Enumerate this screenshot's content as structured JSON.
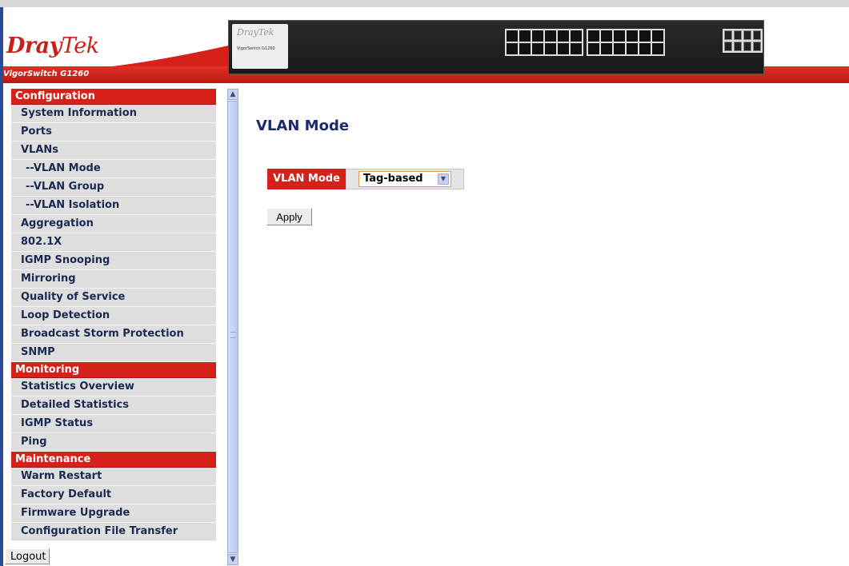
{
  "header": {
    "logo_bold": "Dray",
    "logo_rest": "Tek",
    "model": "VigorSwitch G1260",
    "device_logo": "DrayTek",
    "device_model": "VigorSwitch G1260"
  },
  "sidebar": {
    "sections": [
      {
        "title": "Configuration",
        "items": [
          {
            "label": "System Information",
            "sub": false
          },
          {
            "label": "Ports",
            "sub": false
          },
          {
            "label": "VLANs",
            "sub": false
          },
          {
            "label": "--VLAN Mode",
            "sub": true
          },
          {
            "label": "--VLAN Group",
            "sub": true
          },
          {
            "label": "--VLAN Isolation",
            "sub": true
          },
          {
            "label": "Aggregation",
            "sub": false
          },
          {
            "label": "802.1X",
            "sub": false
          },
          {
            "label": "IGMP Snooping",
            "sub": false
          },
          {
            "label": "Mirroring",
            "sub": false
          },
          {
            "label": "Quality of Service",
            "sub": false
          },
          {
            "label": "Loop Detection",
            "sub": false
          },
          {
            "label": "Broadcast Storm Protection",
            "sub": false
          },
          {
            "label": "SNMP",
            "sub": false
          }
        ]
      },
      {
        "title": "Monitoring",
        "items": [
          {
            "label": "Statistics Overview",
            "sub": false
          },
          {
            "label": "Detailed Statistics",
            "sub": false
          },
          {
            "label": "IGMP Status",
            "sub": false
          },
          {
            "label": "Ping",
            "sub": false
          }
        ]
      },
      {
        "title": "Maintenance",
        "items": [
          {
            "label": "Warm Restart",
            "sub": false
          },
          {
            "label": "Factory Default",
            "sub": false
          },
          {
            "label": "Firmware Upgrade",
            "sub": false
          },
          {
            "label": "Configuration File Transfer",
            "sub": false
          }
        ]
      }
    ],
    "logout_label": "Logout"
  },
  "main": {
    "title": "VLAN Mode",
    "field_label": "VLAN Mode",
    "select_value": "Tag-based",
    "apply_label": "Apply"
  },
  "colors": {
    "accent_red": "#d6211a",
    "nav_text": "#1a2a52",
    "title_blue": "#1a2a6a"
  }
}
